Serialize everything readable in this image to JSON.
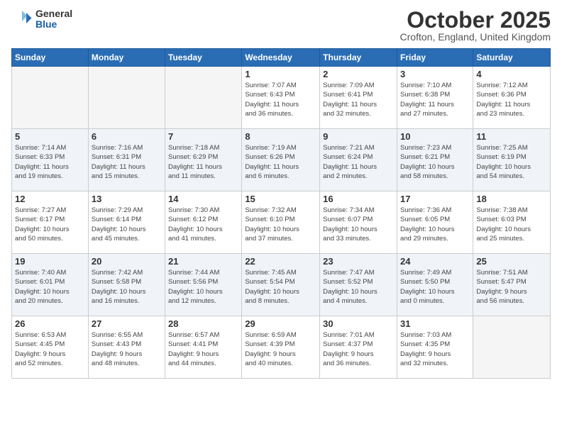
{
  "logo": {
    "general": "General",
    "blue": "Blue"
  },
  "title": "October 2025",
  "subtitle": "Crofton, England, United Kingdom",
  "days_of_week": [
    "Sunday",
    "Monday",
    "Tuesday",
    "Wednesday",
    "Thursday",
    "Friday",
    "Saturday"
  ],
  "weeks": [
    [
      {
        "day": "",
        "info": ""
      },
      {
        "day": "",
        "info": ""
      },
      {
        "day": "",
        "info": ""
      },
      {
        "day": "1",
        "info": "Sunrise: 7:07 AM\nSunset: 6:43 PM\nDaylight: 11 hours\nand 36 minutes."
      },
      {
        "day": "2",
        "info": "Sunrise: 7:09 AM\nSunset: 6:41 PM\nDaylight: 11 hours\nand 32 minutes."
      },
      {
        "day": "3",
        "info": "Sunrise: 7:10 AM\nSunset: 6:38 PM\nDaylight: 11 hours\nand 27 minutes."
      },
      {
        "day": "4",
        "info": "Sunrise: 7:12 AM\nSunset: 6:36 PM\nDaylight: 11 hours\nand 23 minutes."
      }
    ],
    [
      {
        "day": "5",
        "info": "Sunrise: 7:14 AM\nSunset: 6:33 PM\nDaylight: 11 hours\nand 19 minutes."
      },
      {
        "day": "6",
        "info": "Sunrise: 7:16 AM\nSunset: 6:31 PM\nDaylight: 11 hours\nand 15 minutes."
      },
      {
        "day": "7",
        "info": "Sunrise: 7:18 AM\nSunset: 6:29 PM\nDaylight: 11 hours\nand 11 minutes."
      },
      {
        "day": "8",
        "info": "Sunrise: 7:19 AM\nSunset: 6:26 PM\nDaylight: 11 hours\nand 6 minutes."
      },
      {
        "day": "9",
        "info": "Sunrise: 7:21 AM\nSunset: 6:24 PM\nDaylight: 11 hours\nand 2 minutes."
      },
      {
        "day": "10",
        "info": "Sunrise: 7:23 AM\nSunset: 6:21 PM\nDaylight: 10 hours\nand 58 minutes."
      },
      {
        "day": "11",
        "info": "Sunrise: 7:25 AM\nSunset: 6:19 PM\nDaylight: 10 hours\nand 54 minutes."
      }
    ],
    [
      {
        "day": "12",
        "info": "Sunrise: 7:27 AM\nSunset: 6:17 PM\nDaylight: 10 hours\nand 50 minutes."
      },
      {
        "day": "13",
        "info": "Sunrise: 7:29 AM\nSunset: 6:14 PM\nDaylight: 10 hours\nand 45 minutes."
      },
      {
        "day": "14",
        "info": "Sunrise: 7:30 AM\nSunset: 6:12 PM\nDaylight: 10 hours\nand 41 minutes."
      },
      {
        "day": "15",
        "info": "Sunrise: 7:32 AM\nSunset: 6:10 PM\nDaylight: 10 hours\nand 37 minutes."
      },
      {
        "day": "16",
        "info": "Sunrise: 7:34 AM\nSunset: 6:07 PM\nDaylight: 10 hours\nand 33 minutes."
      },
      {
        "day": "17",
        "info": "Sunrise: 7:36 AM\nSunset: 6:05 PM\nDaylight: 10 hours\nand 29 minutes."
      },
      {
        "day": "18",
        "info": "Sunrise: 7:38 AM\nSunset: 6:03 PM\nDaylight: 10 hours\nand 25 minutes."
      }
    ],
    [
      {
        "day": "19",
        "info": "Sunrise: 7:40 AM\nSunset: 6:01 PM\nDaylight: 10 hours\nand 20 minutes."
      },
      {
        "day": "20",
        "info": "Sunrise: 7:42 AM\nSunset: 5:58 PM\nDaylight: 10 hours\nand 16 minutes."
      },
      {
        "day": "21",
        "info": "Sunrise: 7:44 AM\nSunset: 5:56 PM\nDaylight: 10 hours\nand 12 minutes."
      },
      {
        "day": "22",
        "info": "Sunrise: 7:45 AM\nSunset: 5:54 PM\nDaylight: 10 hours\nand 8 minutes."
      },
      {
        "day": "23",
        "info": "Sunrise: 7:47 AM\nSunset: 5:52 PM\nDaylight: 10 hours\nand 4 minutes."
      },
      {
        "day": "24",
        "info": "Sunrise: 7:49 AM\nSunset: 5:50 PM\nDaylight: 10 hours\nand 0 minutes."
      },
      {
        "day": "25",
        "info": "Sunrise: 7:51 AM\nSunset: 5:47 PM\nDaylight: 9 hours\nand 56 minutes."
      }
    ],
    [
      {
        "day": "26",
        "info": "Sunrise: 6:53 AM\nSunset: 4:45 PM\nDaylight: 9 hours\nand 52 minutes."
      },
      {
        "day": "27",
        "info": "Sunrise: 6:55 AM\nSunset: 4:43 PM\nDaylight: 9 hours\nand 48 minutes."
      },
      {
        "day": "28",
        "info": "Sunrise: 6:57 AM\nSunset: 4:41 PM\nDaylight: 9 hours\nand 44 minutes."
      },
      {
        "day": "29",
        "info": "Sunrise: 6:59 AM\nSunset: 4:39 PM\nDaylight: 9 hours\nand 40 minutes."
      },
      {
        "day": "30",
        "info": "Sunrise: 7:01 AM\nSunset: 4:37 PM\nDaylight: 9 hours\nand 36 minutes."
      },
      {
        "day": "31",
        "info": "Sunrise: 7:03 AM\nSunset: 4:35 PM\nDaylight: 9 hours\nand 32 minutes."
      },
      {
        "day": "",
        "info": ""
      }
    ]
  ]
}
